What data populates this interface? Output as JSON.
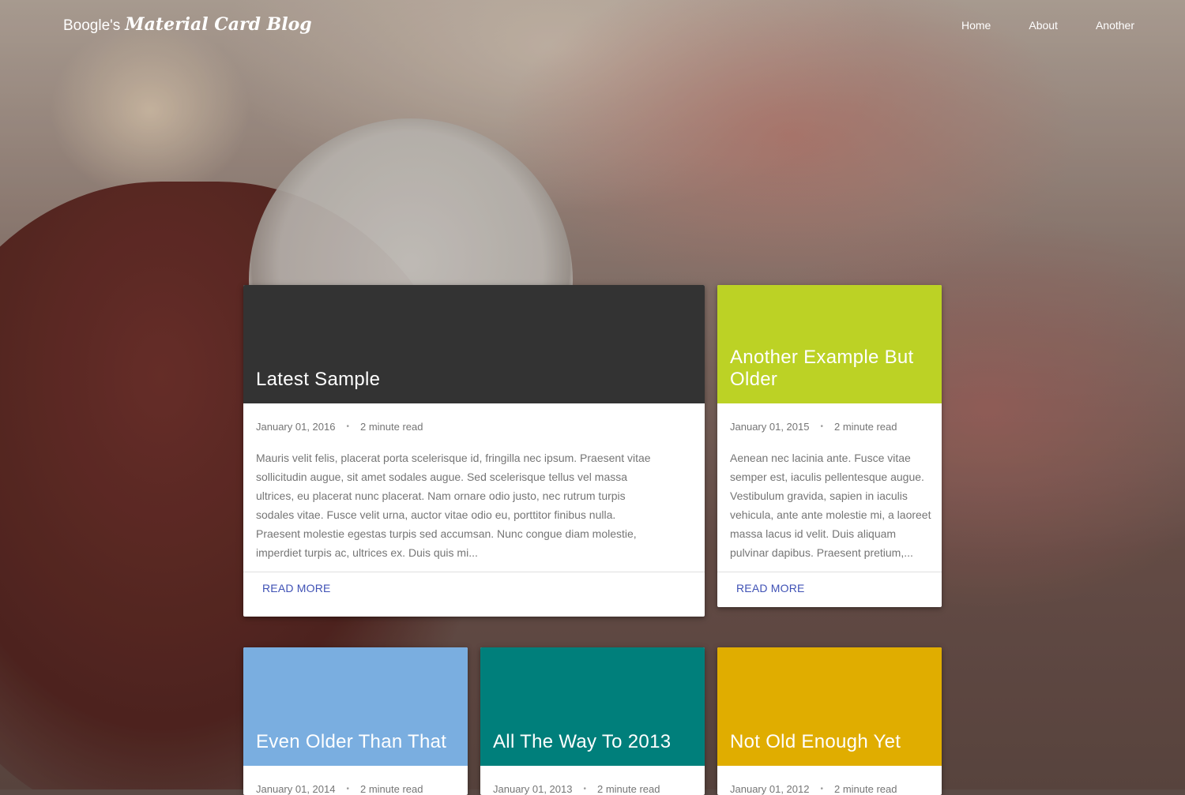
{
  "header": {
    "brand_prefix": "Boogle's",
    "brand_fancy": "Material Card Blog",
    "nav": [
      "Home",
      "About",
      "Another"
    ]
  },
  "cards": [
    {
      "title": "Latest Sample",
      "color": "#333333",
      "date": "January 01, 2016",
      "read_time": "2 minute read",
      "excerpt": "Mauris velit felis, placerat porta scelerisque id, fringilla nec ipsum. Praesent vitae sollicitudin augue, sit amet sodales augue. Sed scelerisque tellus vel massa ultrices, eu placerat nunc placerat. Nam ornare odio justo, nec rutrum turpis sodales vitae. Fusce velit urna, auctor vitae odio eu, porttitor finibus nulla. Praesent molestie egestas turpis sed accumsan. Nunc congue diam molestie, imperdiet turpis ac, ultrices ex. Duis quis mi...",
      "action": "READ MORE"
    },
    {
      "title": "Another Example But Older",
      "color": "#bcd225",
      "date": "January 01, 2015",
      "read_time": "2 minute read",
      "excerpt": "Aenean nec lacinia ante. Fusce vitae semper est, iaculis pellentesque augue. Vestibulum gravida, sapien in iaculis vehicula, ante ante molestie mi, a laoreet massa lacus id velit. Duis aliquam pulvinar dapibus. Praesent pretium,...",
      "action": "READ MORE"
    },
    {
      "title": "Even Older Than That",
      "color": "#7aaee0",
      "date": "January 01, 2014",
      "read_time": "2 minute read"
    },
    {
      "title": "All The Way To 2013",
      "color": "#007f7b",
      "date": "January 01, 2013",
      "read_time": "2 minute read"
    },
    {
      "title": "Not Old Enough Yet",
      "color": "#e0ad00",
      "date": "January 01, 2012",
      "read_time": "2 minute read"
    }
  ]
}
